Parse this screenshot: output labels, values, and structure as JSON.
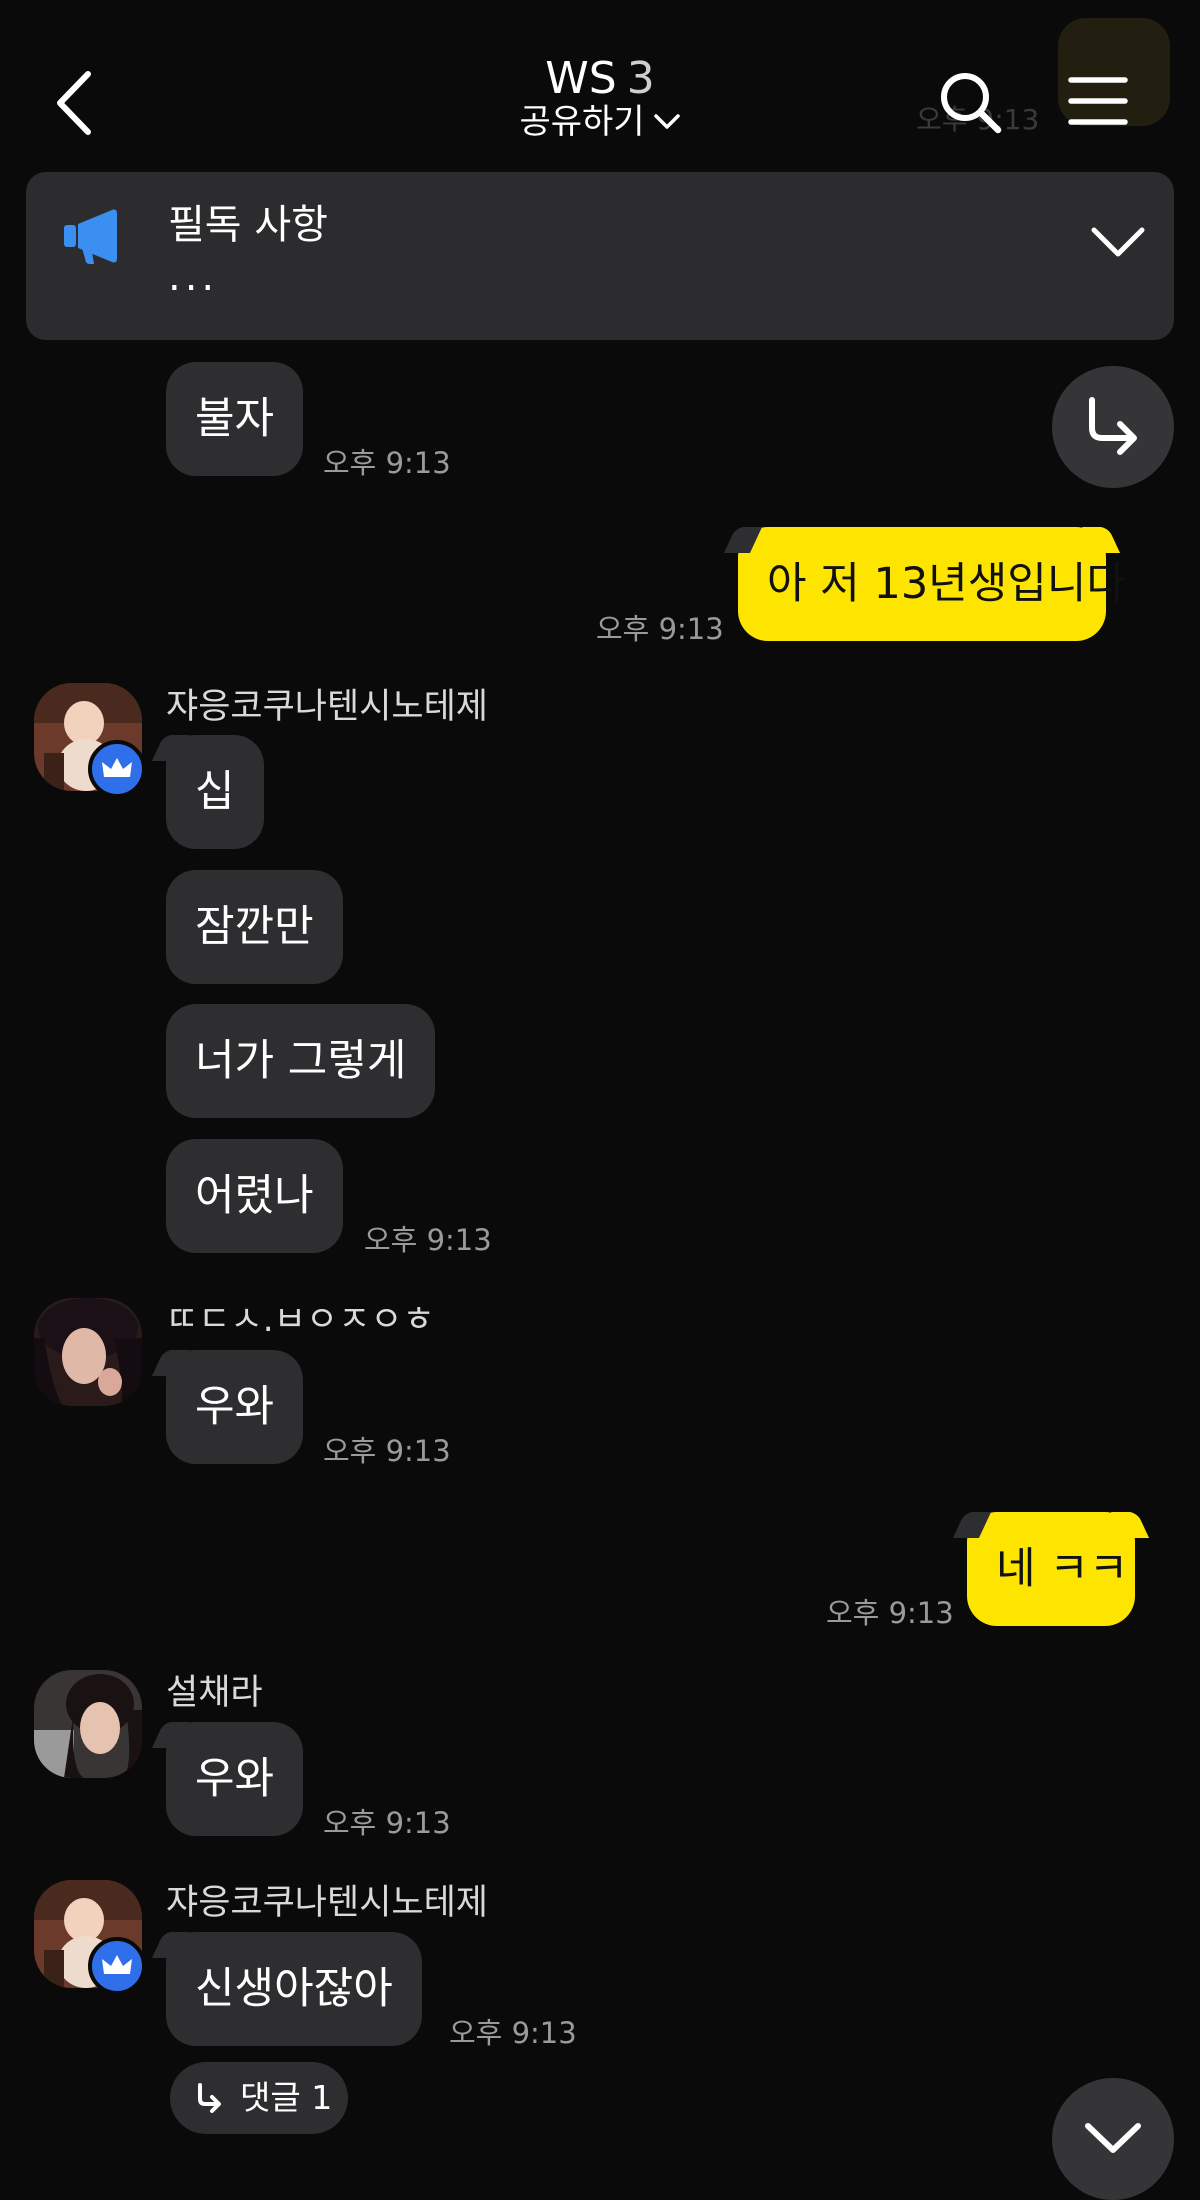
{
  "header": {
    "title": "WS",
    "member_count": "3",
    "subtitle": "공유하기",
    "icons": [
      "back-arrow-icon",
      "search-icon",
      "menu-icon",
      "chevron-down-icon"
    ],
    "ghost_time": "오후 9:13"
  },
  "notice": {
    "title": "필독 사항",
    "body": "...",
    "icon": "megaphone-icon",
    "expand_icon": "chevron-down-icon"
  },
  "colors": {
    "background": "#0a0a0a",
    "bubble_other": "#2e2e30",
    "bubble_me": "#fee500",
    "notice_bg": "#2c2c2e",
    "crown_badge": "#2f6fea",
    "megaphone": "#3a8ff0"
  },
  "messages": [
    {
      "text": "불자",
      "time": "오후 9:13"
    },
    {
      "text": "아 저 13년생입니다",
      "time": "오후 9:13",
      "mine": true
    },
    {
      "sender": "쟈응코쿠나텐시노테제",
      "text": "십"
    },
    {
      "text": "잠깐만"
    },
    {
      "text": "너가 그렇게"
    },
    {
      "text": "어렸나",
      "time": "오후 9:13"
    },
    {
      "sender": "ㄸㄷㅅ.ㅂㅇㅈㅇㅎ",
      "text": "우와",
      "time": "오후 9:13"
    },
    {
      "text": "네 ㅋㅋ",
      "time": "오후 9:13",
      "mine": true
    },
    {
      "sender": "설채라",
      "text": "우와",
      "time": "오후 9:13"
    },
    {
      "sender": "쟈응코쿠나텐시노테제",
      "text": "신생아잖아",
      "time": "오후 9:13"
    }
  ],
  "reply_chip": {
    "label": "댓글 1",
    "icon": "reply-arrow-icon"
  },
  "float_buttons": [
    "share-arrow-icon",
    "scroll-down-icon"
  ]
}
